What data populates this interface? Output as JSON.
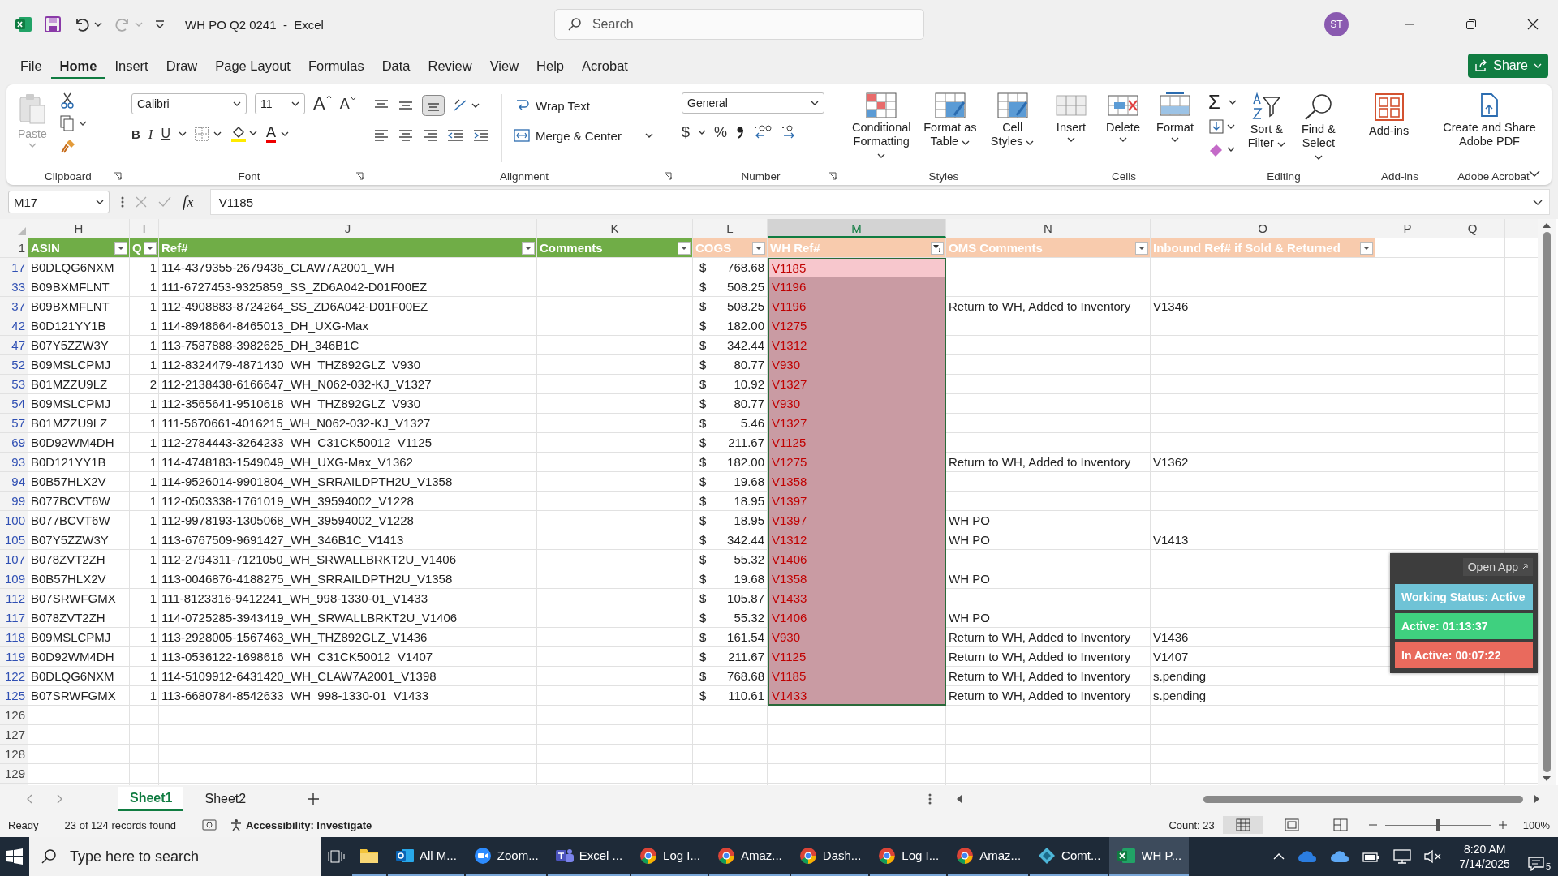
{
  "title_bar": {
    "title": "WH PO Q2 0241  -  Excel",
    "search_placeholder": "Search",
    "user_initials": "ST"
  },
  "menu_tabs": [
    {
      "label": "File",
      "selected": false
    },
    {
      "label": "Home",
      "selected": true
    },
    {
      "label": "Insert",
      "selected": false
    },
    {
      "label": "Draw",
      "selected": false
    },
    {
      "label": "Page Layout",
      "selected": false
    },
    {
      "label": "Formulas",
      "selected": false
    },
    {
      "label": "Data",
      "selected": false
    },
    {
      "label": "Review",
      "selected": false
    },
    {
      "label": "View",
      "selected": false
    },
    {
      "label": "Help",
      "selected": false
    },
    {
      "label": "Acrobat",
      "selected": false
    }
  ],
  "share_button": "Share",
  "ribbon": {
    "clipboard": {
      "paste": "Paste",
      "label": "Clipboard"
    },
    "font": {
      "font_name": "Calibri",
      "font_size": "11",
      "grow": "A",
      "shrink": "A",
      "bold": "B",
      "italic": "I",
      "underline": "U",
      "font_color": "A",
      "label": "Font"
    },
    "alignment": {
      "wrap_text": "Wrap Text",
      "merge_center": "Merge & Center",
      "label": "Alignment"
    },
    "number": {
      "format": "General",
      "currency": "$",
      "percent": "%",
      "label": "Number"
    },
    "styles": {
      "buttons": [
        "Conditional Formatting",
        "Format as Table",
        "Cell Styles"
      ],
      "label": "Styles"
    },
    "cells": {
      "buttons": [
        "Insert",
        "Delete",
        "Format"
      ],
      "label": "Cells"
    },
    "editing": {
      "sigma": "Σ",
      "buttons": [
        "Sort & Filter",
        "Find & Select"
      ],
      "label": "Editing"
    },
    "addins": {
      "button": "Add-ins",
      "label": "Add-ins"
    },
    "acrobat": {
      "button": "Create and Share Adobe PDF",
      "label": "Adobe Acrobat"
    }
  },
  "formula_bar": {
    "name_box": "M17",
    "fx": "fx",
    "value": "V1185"
  },
  "columns": [
    {
      "letter": "H",
      "selected": false
    },
    {
      "letter": "I",
      "selected": false
    },
    {
      "letter": "J",
      "selected": false
    },
    {
      "letter": "K",
      "selected": false
    },
    {
      "letter": "L",
      "selected": false
    },
    {
      "letter": "M",
      "selected": true
    },
    {
      "letter": "N",
      "selected": false
    },
    {
      "letter": "O",
      "selected": false
    },
    {
      "letter": "P",
      "selected": false
    },
    {
      "letter": "Q",
      "selected": false
    }
  ],
  "header_row": {
    "number": "1",
    "cells": [
      {
        "label": "ASIN",
        "color": "#70ad47",
        "filtered": false
      },
      {
        "label": "Q",
        "color": "#70ad47",
        "filtered": false
      },
      {
        "label": "Ref#",
        "color": "#70ad47",
        "filtered": false
      },
      {
        "label": "Comments",
        "color": "#70ad47",
        "filtered": false
      },
      {
        "label": "COGS",
        "color": "#f8cbad",
        "filtered": false
      },
      {
        "label": "WH Ref#",
        "color": "#f8cbad",
        "filtered": true
      },
      {
        "label": "OMS Comments",
        "color": "#f8cbad",
        "filtered": false
      },
      {
        "label": "Inbound Ref# if Sold & Returned",
        "color": "#f8cbad",
        "filtered": false
      }
    ]
  },
  "rows": [
    {
      "number": "17",
      "asin": "B0DLQG6NXM",
      "qty": "1",
      "ref": "114-4379355-2679436_CLAW7A2001_WH",
      "currency": "$",
      "cogs": "768.68",
      "wh_ref": "V1185",
      "active": true
    },
    {
      "number": "33",
      "asin": "B09BXMFLNT",
      "qty": "1",
      "ref": "111-6727453-9325859_SS_ZD6A042-D01F00EZ",
      "currency": "$",
      "cogs": "508.25",
      "wh_ref": "V1196",
      "active": false
    },
    {
      "number": "37",
      "asin": "B09BXMFLNT",
      "qty": "1",
      "ref": "112-4908883-8724264_SS_ZD6A042-D01F00EZ",
      "currency": "$",
      "cogs": "508.25",
      "wh_ref": "V1196",
      "oms": "Return to WH, Added to Inventory",
      "inbound": "V1346",
      "active": false
    },
    {
      "number": "42",
      "asin": "B0D121YY1B",
      "qty": "1",
      "ref": "114-8948664-8465013_DH_UXG-Max",
      "currency": "$",
      "cogs": "182.00",
      "wh_ref": "V1275",
      "active": false
    },
    {
      "number": "47",
      "asin": "B07Y5ZZW3Y",
      "qty": "1",
      "ref": "113-7587888-3982625_DH_346B1C",
      "currency": "$",
      "cogs": "342.44",
      "wh_ref": "V1312",
      "active": false
    },
    {
      "number": "52",
      "asin": "B09MSLCPMJ",
      "qty": "1",
      "ref": "112-8324479-4871430_WH_THZ892GLZ_V930",
      "currency": "$",
      "cogs": "80.77",
      "wh_ref": "V930",
      "active": false
    },
    {
      "number": "53",
      "asin": "B01MZZU9LZ",
      "qty": "2",
      "ref": "112-2138438-6166647_WH_N062-032-KJ_V1327",
      "currency": "$",
      "cogs": "10.92",
      "wh_ref": "V1327",
      "active": false
    },
    {
      "number": "54",
      "asin": "B09MSLCPMJ",
      "qty": "1",
      "ref": "112-3565641-9510618_WH_THZ892GLZ_V930",
      "currency": "$",
      "cogs": "80.77",
      "wh_ref": "V930",
      "active": false
    },
    {
      "number": "57",
      "asin": "B01MZZU9LZ",
      "qty": "1",
      "ref": "111-5670661-4016215_WH_N062-032-KJ_V1327",
      "currency": "$",
      "cogs": "5.46",
      "wh_ref": "V1327",
      "active": false
    },
    {
      "number": "69",
      "asin": "B0D92WM4DH",
      "qty": "1",
      "ref": "112-2784443-3264233_WH_C31CK50012_V1125",
      "currency": "$",
      "cogs": "211.67",
      "wh_ref": "V1125",
      "active": false
    },
    {
      "number": "93",
      "asin": "B0D121YY1B",
      "qty": "1",
      "ref": "114-4748183-1549049_WH_UXG-Max_V1362",
      "currency": "$",
      "cogs": "182.00",
      "wh_ref": "V1275",
      "oms": "Return to WH, Added to Inventory",
      "inbound": "V1362",
      "active": false
    },
    {
      "number": "94",
      "asin": "B0B57HLX2V",
      "qty": "1",
      "ref": "114-9526014-9901804_WH_SRRAILDPTH2U_V1358",
      "currency": "$",
      "cogs": "19.68",
      "wh_ref": "V1358",
      "active": false
    },
    {
      "number": "99",
      "asin": "B077BCVT6W",
      "qty": "1",
      "ref": "112-0503338-1761019_WH_39594002_V1228",
      "currency": "$",
      "cogs": "18.95",
      "wh_ref": "V1397",
      "active": false
    },
    {
      "number": "100",
      "asin": "B077BCVT6W",
      "qty": "1",
      "ref": "112-9978193-1305068_WH_39594002_V1228",
      "currency": "$",
      "cogs": "18.95",
      "wh_ref": "V1397",
      "oms": "WH PO",
      "active": false
    },
    {
      "number": "105",
      "asin": "B07Y5ZZW3Y",
      "qty": "1",
      "ref": "113-6767509-9691427_WH_346B1C_V1413",
      "currency": "$",
      "cogs": "342.44",
      "wh_ref": "V1312",
      "oms": "WH PO",
      "inbound": "V1413",
      "active": false
    },
    {
      "number": "107",
      "asin": "B078ZVT2ZH",
      "qty": "1",
      "ref": "112-2794311-7121050_WH_SRWALLBRKT2U_V1406",
      "currency": "$",
      "cogs": "55.32",
      "wh_ref": "V1406",
      "active": false
    },
    {
      "number": "109",
      "asin": "B0B57HLX2V",
      "qty": "1",
      "ref": "113-0046876-4188275_WH_SRRAILDPTH2U_V1358",
      "currency": "$",
      "cogs": "19.68",
      "wh_ref": "V1358",
      "oms": "WH PO",
      "active": false
    },
    {
      "number": "112",
      "asin": "B07SRWFGMX",
      "qty": "1",
      "ref": "111-8123316-9412241_WH_998-1330-01_V1433",
      "currency": "$",
      "cogs": "105.87",
      "wh_ref": "V1433",
      "active": false
    },
    {
      "number": "117",
      "asin": "B078ZVT2ZH",
      "qty": "1",
      "ref": "114-0725285-3943419_WH_SRWALLBRKT2U_V1406",
      "currency": "$",
      "cogs": "55.32",
      "wh_ref": "V1406",
      "oms": "WH PO",
      "active": false
    },
    {
      "number": "118",
      "asin": "B09MSLCPMJ",
      "qty": "1",
      "ref": "113-2928005-1567463_WH_THZ892GLZ_V1436",
      "currency": "$",
      "cogs": "161.54",
      "wh_ref": "V930",
      "oms": "Return to WH, Added to Inventory",
      "inbound": "V1436",
      "active": false
    },
    {
      "number": "119",
      "asin": "B0D92WM4DH",
      "qty": "1",
      "ref": "113-0536122-1698616_WH_C31CK50012_V1407",
      "currency": "$",
      "cogs": "211.67",
      "wh_ref": "V1125",
      "oms": "Return to WH, Added to Inventory",
      "inbound": "V1407",
      "active": false
    },
    {
      "number": "122",
      "asin": "B0DLQG6NXM",
      "qty": "1",
      "ref": "114-5109912-6431420_WH_CLAW7A2001_V1398",
      "currency": "$",
      "cogs": "768.68",
      "wh_ref": "V1185",
      "oms": "Return to WH, Added to Inventory",
      "inbound": "s.pending",
      "active": false
    },
    {
      "number": "125",
      "asin": "B07SRWFGMX",
      "qty": "1",
      "ref": "113-6680784-8542633_WH_998-1330-01_V1433",
      "currency": "$",
      "cogs": "110.61",
      "wh_ref": "V1433",
      "oms": "Return to WH, Added to Inventory",
      "inbound": "s.pending",
      "active": false
    }
  ],
  "empty_rows": [
    "126",
    "127",
    "128",
    "129"
  ],
  "tracker_widget": {
    "open_app": "Open App",
    "status": "Working Status: Active",
    "active": "Active: 01:13:37",
    "inactive": "In Active: 00:07:22"
  },
  "sheet_tabs": [
    {
      "label": "Sheet1",
      "selected": true
    },
    {
      "label": "Sheet2",
      "selected": false
    }
  ],
  "status_bar": {
    "mode": "Ready",
    "records": "23 of 124 records found",
    "accessibility": "Accessibility: Investigate",
    "count": "Count: 23",
    "zoom": "100%",
    "zoom_slider": {
      "level": 0.5
    }
  },
  "taskbar": {
    "search_placeholder": "Type here to search",
    "apps": [
      {
        "kind": "folder",
        "active": false
      },
      {
        "kind": "mail",
        "label": "All M...",
        "active": false
      },
      {
        "kind": "video",
        "label": "Zoom...",
        "active": false
      },
      {
        "kind": "chat",
        "label": "Excel ...",
        "active": false
      },
      {
        "kind": "browser",
        "label": "Log I...",
        "active": false
      },
      {
        "kind": "browser",
        "label": "Amaz...",
        "active": false
      },
      {
        "kind": "browser",
        "label": "Dash...",
        "active": false
      },
      {
        "kind": "browser",
        "label": "Log I...",
        "active": false
      },
      {
        "kind": "browser",
        "label": "Amaz...",
        "active": false
      },
      {
        "kind": "diamond",
        "label": "Comt...",
        "active": false
      },
      {
        "kind": "spreadsheet",
        "label": "WH P...",
        "active": true
      }
    ],
    "time": "8:20 AM",
    "date": "7/14/2025",
    "notifications": "5"
  }
}
